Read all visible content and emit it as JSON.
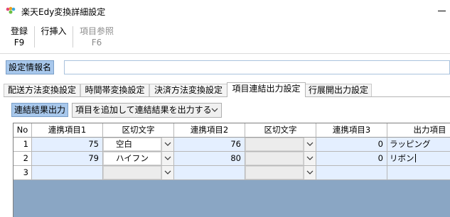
{
  "window": {
    "title": "楽天Edy変換詳細設定"
  },
  "toolbar": {
    "buttons": [
      {
        "label": "登録",
        "key": "F9",
        "enabled": true
      },
      {
        "label": "行挿入",
        "key": "",
        "enabled": true
      },
      {
        "label": "項目参照",
        "key": "F6",
        "enabled": false
      }
    ]
  },
  "settings": {
    "label": "設定情報名",
    "value": ""
  },
  "tabs": [
    {
      "label": "配送方法変換設定",
      "active": false
    },
    {
      "label": "時間帯変換設定",
      "active": false
    },
    {
      "label": "決済方法変換設定",
      "active": false
    },
    {
      "label": "項目連結出力設定",
      "active": true
    },
    {
      "label": "行展開出力設定",
      "active": false
    }
  ],
  "output": {
    "label": "連結結果出力",
    "selected": "項目を追加して連結結果を出力する"
  },
  "grid": {
    "headers": [
      "No",
      "連携項目1",
      "区切文字",
      "連携項目2",
      "区切文字",
      "連携項目3",
      "出力項目"
    ],
    "rows": [
      {
        "no": "1",
        "item1": "75",
        "sep1": "空白",
        "item2": "76",
        "sep2": "",
        "item3": "0",
        "output": "ラッピング"
      },
      {
        "no": "2",
        "item1": "79",
        "sep1": "ハイフン",
        "item2": "80",
        "sep2": "",
        "item3": "0",
        "output": "リボン"
      },
      {
        "no": "3",
        "item1": "",
        "sep1": "",
        "item2": "",
        "sep2": "",
        "item3": "",
        "output": ""
      }
    ]
  },
  "colors": {
    "label_bg": "#a8c8ec",
    "grid_bg": "#8aa6c4",
    "cell_bg": "#e4efff"
  }
}
